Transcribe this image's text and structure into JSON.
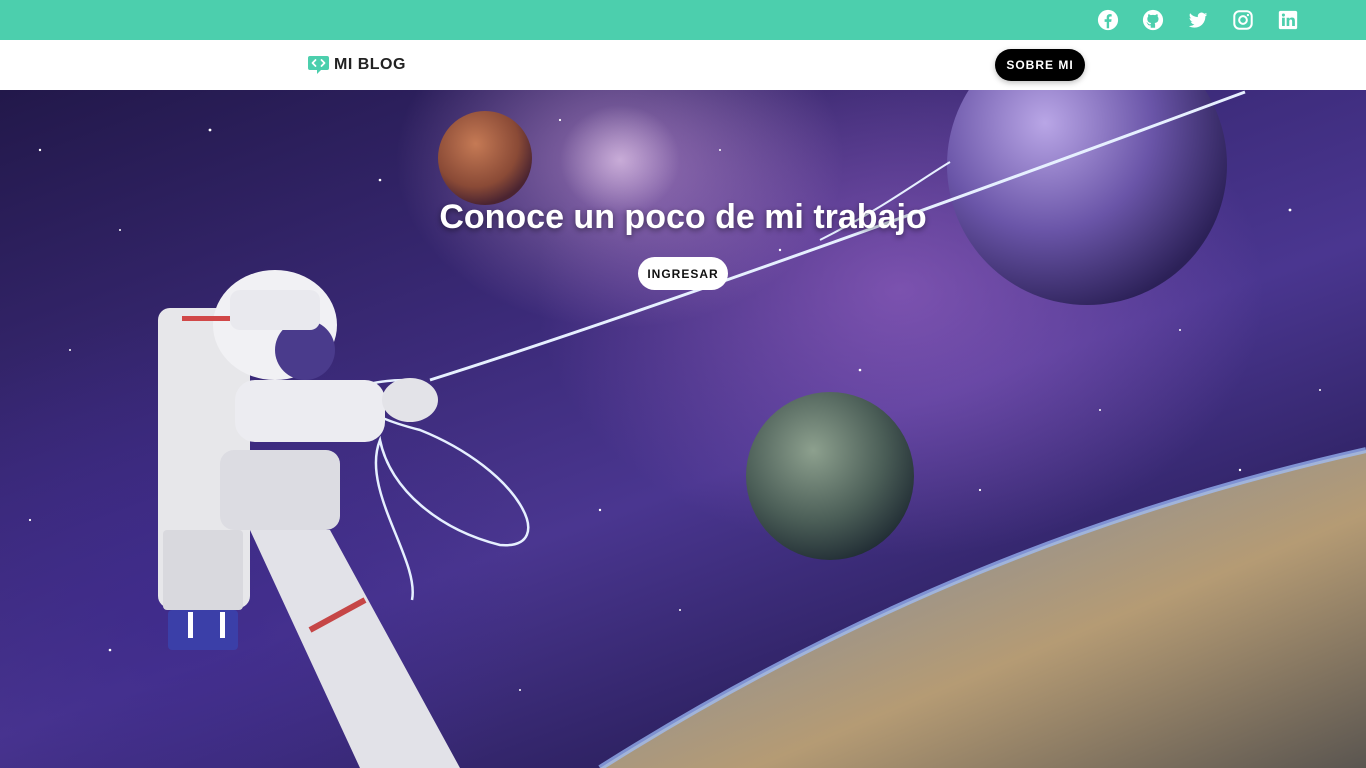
{
  "colors": {
    "topbar": "#4ccfad",
    "navbar": "#ffffff",
    "about_button_bg": "#000000",
    "enter_button_bg": "#ffffff"
  },
  "topbar": {
    "social_icons": [
      "facebook-icon",
      "github-icon",
      "twitter-icon",
      "instagram-icon",
      "linkedin-icon"
    ]
  },
  "navbar": {
    "brand_icon": "code-bubble-icon",
    "brand_text": "MI BLOG",
    "about_label": "SOBRE MI"
  },
  "hero": {
    "title": "Conoce un poco de mi trabajo",
    "cta_label": "INGRESAR"
  }
}
